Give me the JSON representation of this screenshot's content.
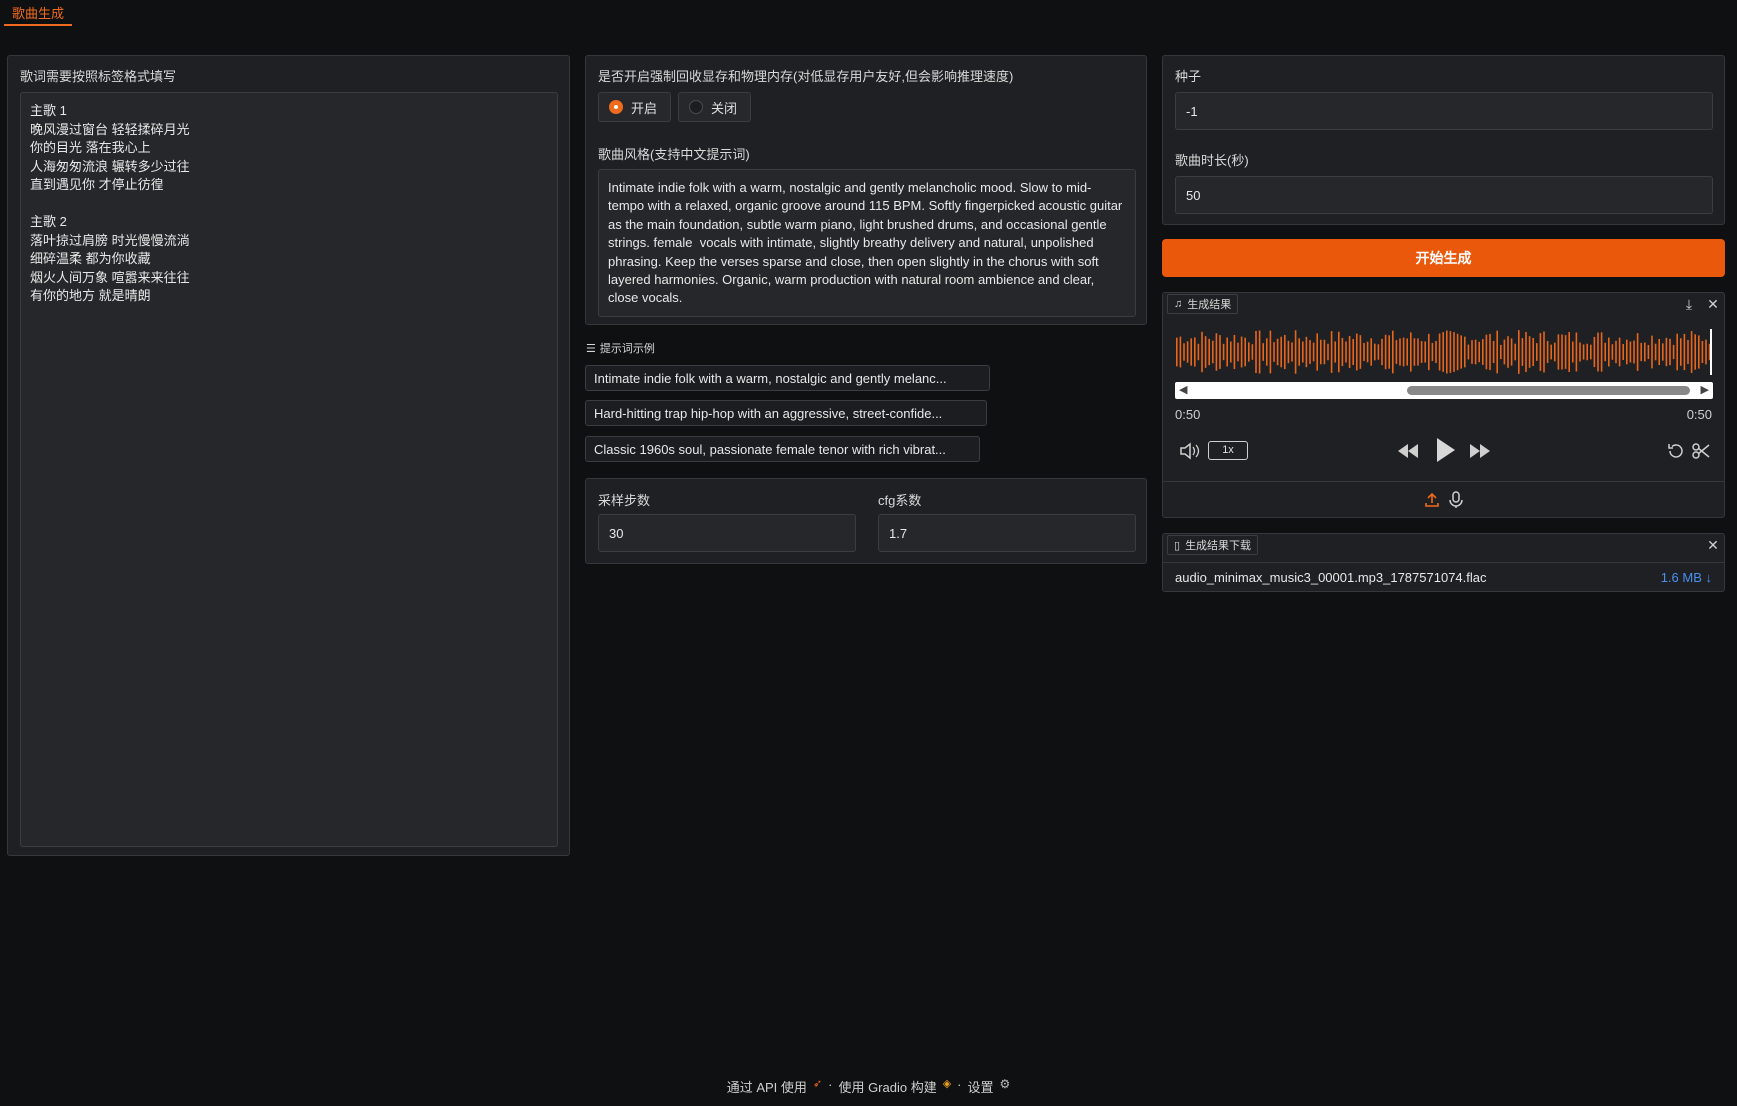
{
  "tabs": [
    {
      "label": "歌曲生成"
    }
  ],
  "lyrics": {
    "label": "歌词需要按照标签格式填写",
    "value": "主歌 1\n晚风漫过窗台 轻轻揉碎月光\n你的目光 落在我心上\n人海匆匆流浪 辗转多少过往\n直到遇见你 才停止彷徨\n\n主歌 2\n落叶掠过肩膀 时光慢慢流淌\n细碎温柔 都为你收藏\n烟火人间万象 喧嚣来来往往\n有你的地方 就是晴朗"
  },
  "memory": {
    "label": "是否开启强制回收显存和物理内存(对低显存用户友好,但会影响推理速度)",
    "options": [
      "开启",
      "关闭"
    ],
    "selected": "开启"
  },
  "style": {
    "label": "歌曲风格(支持中文提示词)",
    "value": "Intimate indie folk with a warm, nostalgic and gently melancholic mood. Slow to mid-tempo with a relaxed, organic groove around 115 BPM. Softly fingerpicked acoustic guitar as the main foundation, subtle warm piano, light brushed drums, and occasional gentle strings. female  vocals with intimate, slightly breathy delivery and natural, unpolished phrasing. Keep the verses sparse and close, then open slightly in the chorus with soft layered harmonies. Organic, warm production with natural room ambience and clear, close vocals."
  },
  "examples": {
    "label": "提示词示例",
    "items": [
      "Intimate indie folk with a warm, nostalgic and gently melanc...",
      "Hard-hitting trap hip-hop with an aggressive, street-confide...",
      "Classic 1960s soul, passionate female tenor with rich vibrat..."
    ]
  },
  "params": {
    "steps_label": "采样步数",
    "steps_value": "30",
    "cfg_label": "cfg系数",
    "cfg_value": "1.7"
  },
  "seed": {
    "label": "种子",
    "value": "-1"
  },
  "duration": {
    "label": "歌曲时长(秒)",
    "value": "50"
  },
  "generate_button": "开始生成",
  "result": {
    "label": "生成结果",
    "time_current": "0:50",
    "time_total": "0:50",
    "speed": "1x",
    "waveform_color": "#e8651c"
  },
  "download": {
    "label": "生成结果下载",
    "filename": "audio_minimax_music3_00001.mp3_1787571074.flac",
    "size": "1.6 MB ↓"
  },
  "footer": {
    "api": "通过 API 使用",
    "built": "使用 Gradio 构建",
    "settings": "设置",
    "sep": "·"
  }
}
